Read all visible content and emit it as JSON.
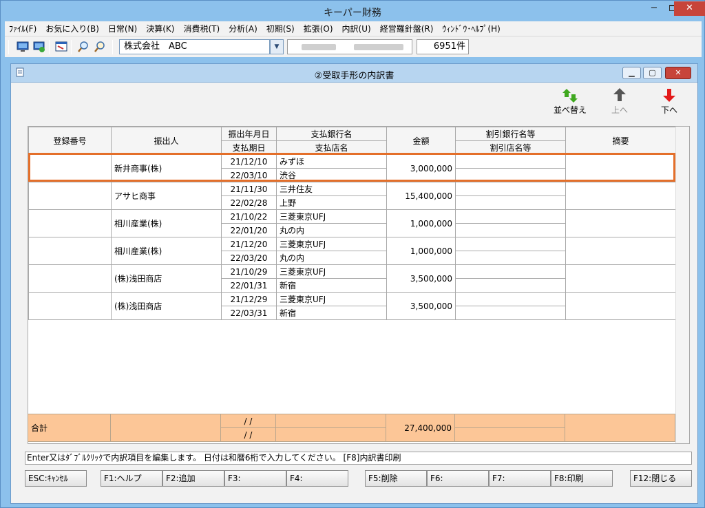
{
  "window": {
    "title": "キーパー財務",
    "minimize": "−",
    "maximize": "",
    "close": "✕"
  },
  "menu": [
    "ﾌｧｲﾙ(F)",
    "お気に入り(B)",
    "日常(N)",
    "決算(K)",
    "消費税(T)",
    "分析(A)",
    "初期(S)",
    "拡張(O)",
    "内訳(U)",
    "経営羅針盤(R)",
    "ｳｨﾝﾄﾞｳ･ﾍﾙﾌﾟ(H)"
  ],
  "toolbar": {
    "company": "株式会社　ABC",
    "record_count": "6951件",
    "icons": [
      "monitor-icon",
      "monitor-refresh-icon",
      "window-icon",
      "zoom-in-icon",
      "zoom-out-icon"
    ]
  },
  "subwindow": {
    "title": "②受取手形の内訳書",
    "minimize": "▁",
    "maximize": "▢",
    "close": "✕"
  },
  "actions": {
    "sort": "並べ替え",
    "up": "上へ",
    "down": "下へ"
  },
  "table": {
    "headers": {
      "reg_no": "登録番号",
      "drawer": "振出人",
      "issue_date": "振出年月日",
      "due_date": "支払期日",
      "bank": "支払銀行名",
      "branch": "支払店名",
      "amount": "金額",
      "discount_bank": "割引銀行名等",
      "discount_branch": "割引店名等",
      "summary": "摘要"
    },
    "rows": [
      {
        "reg_no": "",
        "drawer": "新井商事(株)",
        "issue_date": "21/12/10",
        "due_date": "22/03/10",
        "bank": "みずほ",
        "branch": "渋谷",
        "amount": "3,000,000",
        "discount_bank": "",
        "discount_branch": "",
        "summary": ""
      },
      {
        "reg_no": "",
        "drawer": "アサヒ商事",
        "issue_date": "21/11/30",
        "due_date": "22/02/28",
        "bank": "三井住友",
        "branch": "上野",
        "amount": "15,400,000",
        "discount_bank": "",
        "discount_branch": "",
        "summary": ""
      },
      {
        "reg_no": "",
        "drawer": "相川産業(株)",
        "issue_date": "21/10/22",
        "due_date": "22/01/20",
        "bank": "三菱東京UFJ",
        "branch": "丸の内",
        "amount": "1,000,000",
        "discount_bank": "",
        "discount_branch": "",
        "summary": ""
      },
      {
        "reg_no": "",
        "drawer": "相川産業(株)",
        "issue_date": "21/12/20",
        "due_date": "22/03/20",
        "bank": "三菱東京UFJ",
        "branch": "丸の内",
        "amount": "1,000,000",
        "discount_bank": "",
        "discount_branch": "",
        "summary": ""
      },
      {
        "reg_no": "",
        "drawer": "(株)浅田商店",
        "issue_date": "21/10/29",
        "due_date": "22/01/31",
        "bank": "三菱東京UFJ",
        "branch": "新宿",
        "amount": "3,500,000",
        "discount_bank": "",
        "discount_branch": "",
        "summary": ""
      },
      {
        "reg_no": "",
        "drawer": "(株)浅田商店",
        "issue_date": "21/12/29",
        "due_date": "22/03/31",
        "bank": "三菱東京UFJ",
        "branch": "新宿",
        "amount": "3,500,000",
        "discount_bank": "",
        "discount_branch": "",
        "summary": ""
      }
    ],
    "total": {
      "label": "合計",
      "date1": "/ /",
      "date2": "/ /",
      "amount": "27,400,000"
    }
  },
  "status": "Enter又はﾀﾞﾌﾞﾙｸﾘｯｸで内訳項目を編集します。 日付は和暦6桁で入力してください。 [F8]内訳書印刷",
  "fkeys": [
    "ESC:ｷｬﾝｾﾙ",
    "F1:ヘルプ",
    "F2:追加",
    "F3:",
    "F4:",
    "F5:削除",
    "F6:",
    "F7:",
    "F8:印刷",
    "F12:閉じる"
  ]
}
